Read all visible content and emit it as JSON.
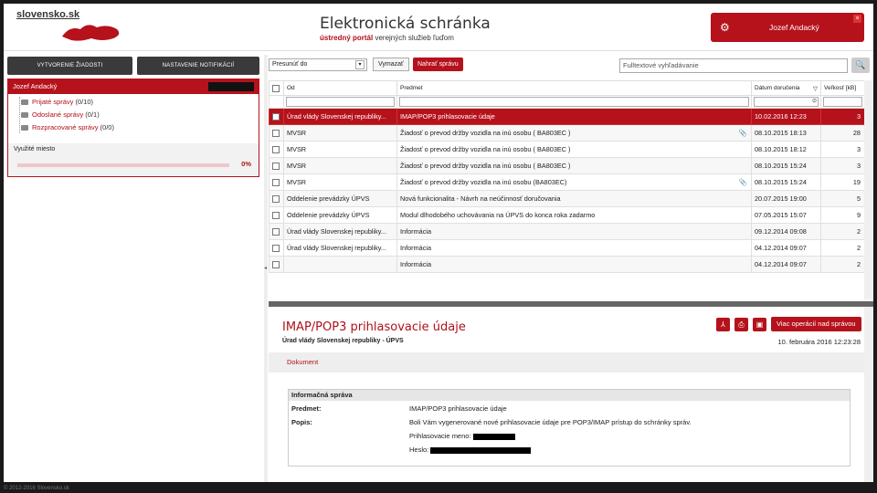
{
  "header": {
    "logo": "slovensko.sk",
    "title": "Elektronická schránka",
    "subtitle_bold": "ústredný portál",
    "subtitle_rest": " verejných služieb ľuďom",
    "user_name": "Jozef Andacký"
  },
  "sidebar": {
    "btn_create": "VYTVORENIE ŽIADOSTI",
    "btn_notify": "NASTAVENIE NOTIFIKÁCIÍ",
    "box_name": "Jozef Andacký",
    "box_badge": "",
    "folders": [
      {
        "label": "Prijaté správy",
        "count": "(0/10)"
      },
      {
        "label": "Odoslané správy",
        "count": "(0/1)"
      },
      {
        "label": "Rozpracované správy",
        "count": "(0/0)"
      }
    ],
    "usage_label": "Využité miesto",
    "usage_percent": "0%",
    "usage_fraction": 0
  },
  "toolbar": {
    "move_to": "Presunúť do",
    "delete": "Vymazať",
    "upload": "Nahrať správu",
    "search_placeholder": "Fulltextové vyhľadávanie"
  },
  "grid": {
    "columns": [
      "Od",
      "Predmet",
      "Dátum doručenia",
      "Veľkosť [kB]"
    ],
    "rows": [
      {
        "from": "Úrad vlády Slovenskej republiky...",
        "subject": "IMAP/POP3 prihlasovacie údaje",
        "date": "10.02.2016 12:23",
        "size": "3",
        "attach": false
      },
      {
        "from": "MVSR",
        "subject": "Žiadosť o prevod držby vozidla na inú osobu ( BA803EC )",
        "date": "08.10.2015 18:13",
        "size": "28",
        "attach": true
      },
      {
        "from": "MVSR",
        "subject": "Žiadosť o prevod držby vozidla na inú osobu ( BA803EC )",
        "date": "08.10.2015 18:12",
        "size": "3",
        "attach": false
      },
      {
        "from": "MVSR",
        "subject": "Žiadosť o prevod držby vozidla na inú osobu ( BA803EC )",
        "date": "08.10.2015 15:24",
        "size": "3",
        "attach": false
      },
      {
        "from": "MVSR",
        "subject": "Žiadosť o prevod držby vozidla na inú osobu (BA803EC)",
        "date": "08.10.2015 15:24",
        "size": "19",
        "attach": true
      },
      {
        "from": "Oddelenie prevádzky ÚPVS",
        "subject": "Nová funkcionalita - Návrh na neúčinnosť doručovania",
        "date": "20.07.2015 19:00",
        "size": "5",
        "attach": false
      },
      {
        "from": "Oddelenie prevádzky ÚPVS",
        "subject": "Modul dlhodobého uchovávania na ÚPVS do konca roka zadarmo",
        "date": "07.05.2015 15:07",
        "size": "9",
        "attach": false
      },
      {
        "from": "Úrad vlády Slovenskej republiky...",
        "subject": "Informácia",
        "date": "09.12.2014 09:08",
        "size": "2",
        "attach": false
      },
      {
        "from": "Úrad vlády Slovenskej republiky...",
        "subject": "Informácia",
        "date": "04.12.2014 09:07",
        "size": "2",
        "attach": false
      },
      {
        "from": "",
        "subject": "Informácia",
        "date": "04.12.2014 09:07",
        "size": "2",
        "attach": false
      }
    ]
  },
  "detail": {
    "title": "IMAP/POP3 prihlasovacie údaje",
    "sender": "Úrad vlády Slovenskej republiky - ÚPVS",
    "date": "10. februára 2016 12:23:28",
    "more_button": "Viac operácií nad správou",
    "tab": "Dokument",
    "info_title": "Informačná správa",
    "subject_label": "Predmet:",
    "subject_value": "IMAP/POP3 prihlasovacie údaje",
    "desc_label": "Popis:",
    "desc_value": "Boli Vám vygenerované nové prihlasovacie údaje pre POP3/IMAP prístup do schránky správ.",
    "login_label": "Prihlasovacie meno:",
    "password_label": "Heslo:"
  },
  "footer": {
    "text": "© 2012-2016 Slovensko.sk"
  }
}
